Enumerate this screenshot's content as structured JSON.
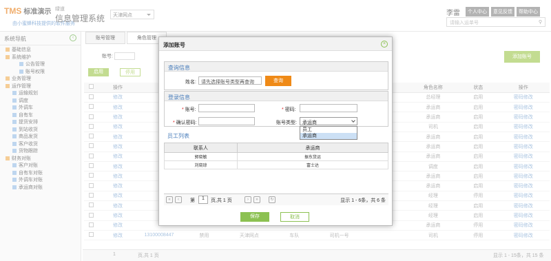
{
  "header": {
    "logo": "TMS",
    "logo_zh": "标准演示",
    "slogan": "由小蜜蜂科技提供的软件服务",
    "sys_small": "绿道",
    "sys_name": "信息管理系统",
    "region": "天津网点",
    "user": "李雷",
    "btn_profile": "个人中心",
    "btn_feedback": "意见反馈",
    "btn_help": "帮助中心",
    "search_placeholder": "请输入运单号"
  },
  "sidebar": {
    "title": "系统导航",
    "items": [
      {
        "label": "基础信息",
        "level": 1
      },
      {
        "label": "系统维护",
        "level": 1
      },
      {
        "label": "公告管理",
        "level": 3
      },
      {
        "label": "账号权限",
        "level": 3
      },
      {
        "label": "业务管理",
        "level": 1
      },
      {
        "label": "运作管理",
        "level": 1
      },
      {
        "label": "运输规划",
        "level": 2
      },
      {
        "label": "调度",
        "level": 2
      },
      {
        "label": "外调车",
        "level": 2
      },
      {
        "label": "自有车",
        "level": 2
      },
      {
        "label": "提货安排",
        "level": 2
      },
      {
        "label": "到站收货",
        "level": 2
      },
      {
        "label": "商品发货",
        "level": 2
      },
      {
        "label": "客户收货",
        "level": 2
      },
      {
        "label": "货物跟踪",
        "level": 2
      },
      {
        "label": "财务对账",
        "level": 1
      },
      {
        "label": "客户对账",
        "level": 2
      },
      {
        "label": "自有车对账",
        "level": 2
      },
      {
        "label": "外调车对账",
        "level": 2
      },
      {
        "label": "承运商对账",
        "level": 2
      }
    ]
  },
  "main": {
    "tab1": "账号管理",
    "tab2": "角色管理",
    "q_label": "账号:",
    "btn_a": "启用",
    "btn_b": "停用",
    "btn_add": "添加账号",
    "columns": [
      "操作",
      "",
      "",
      "",
      "",
      "",
      "",
      "",
      "角色名称",
      "状态",
      "操作"
    ],
    "col_op": "操作",
    "col_role": "角色名称",
    "col_status": "状态",
    "rows": [
      {
        "role": "总经理",
        "status": "启用",
        "op": "密码修改"
      },
      {
        "role": "承运商",
        "status": "启用",
        "op": "密码修改"
      },
      {
        "role": "承运商",
        "status": "启用",
        "op": "密码修改"
      },
      {
        "role": "司机",
        "status": "启用",
        "op": "密码修改"
      },
      {
        "role": "承运商",
        "status": "启用",
        "op": "密码修改"
      },
      {
        "role": "承运商",
        "status": "启用",
        "op": "密码修改"
      },
      {
        "role": "承运商",
        "status": "启用",
        "op": "密码修改"
      },
      {
        "role": "调度",
        "status": "启用",
        "op": "密码修改"
      },
      {
        "role": "承运商",
        "status": "启用",
        "op": "密码修改"
      },
      {
        "role": "承运商",
        "status": "启用",
        "op": "密码修改"
      },
      {
        "role": "经理",
        "status": "停用",
        "op": "密码修改"
      },
      {
        "role": "经理",
        "status": "启用",
        "op": "密码修改"
      },
      {
        "role": "经理",
        "status": "启用",
        "op": "密码修改"
      },
      {
        "role": "承运商",
        "status": "停用",
        "op": "密码修改"
      },
      {
        "role": "司机",
        "status": "停用",
        "op": "密码修改"
      }
    ],
    "row_link": "修改",
    "last_row": {
      "phone": "13100008447",
      "col3": "禁用",
      "col4": "天津网点",
      "col5": "车队",
      "col6": "司机一号"
    },
    "pager_page": "1",
    "pager_of": "页,共 1 页",
    "pager_info": "显示 1 - 15条，共 15 条"
  },
  "dialog": {
    "title": "添加账号",
    "query_title": "查询信息",
    "name_label": "姓名:",
    "name_value": "请先选择账号类型再查询",
    "query_btn": "查询",
    "login_title": "登录信息",
    "account_label": "账号:",
    "password_label": "密码:",
    "confirm_label": "确认密码:",
    "type_label": "账号类型:",
    "type_value": "承运商",
    "type_options": [
      "员工",
      "承运商"
    ],
    "staff_title": "员工列表",
    "col_contact": "联系人",
    "col_carrier": "承运商",
    "staff_rows": [
      {
        "contact": "郭晓敏",
        "carrier": "振东货运"
      },
      {
        "contact": "刘晓琼",
        "carrier": "富士达"
      }
    ],
    "page_label": "第",
    "page_num": "1",
    "page_of": "页,共 1 页",
    "page_info": "显示 1 - 6条，共 6 条",
    "save_btn": "保存",
    "cancel_btn": "取消"
  }
}
